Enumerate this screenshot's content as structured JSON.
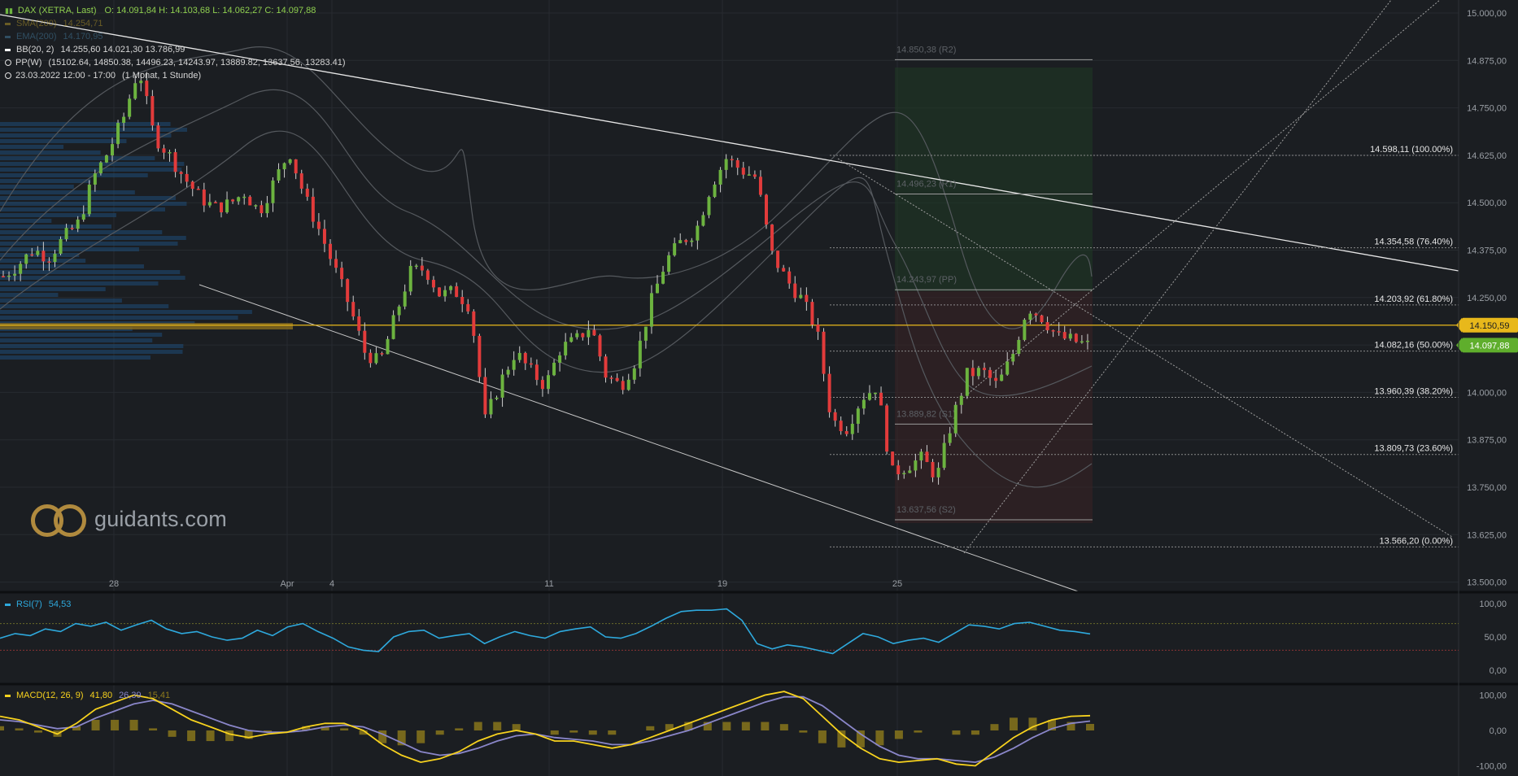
{
  "header": {
    "symbol": "DAX (XETRA, Last)",
    "ohlc": "O: 14.091,84  H: 14.103,68  L: 14.062,27  C: 14.097,88",
    "sma_label": "SMA(200)",
    "sma_value": "14.254,71",
    "ema_label": "EMA(200)",
    "ema_value": "14.170,95",
    "bb_label": "BB(20, 2)",
    "bb_values": "14.255,60  14.021,30  13.786,99",
    "pp_label": "PP(W)",
    "pp_values": "(15102.64, 14850.38, 14496.23, 14243.97, 13889.82, 13637.56, 13283.41)",
    "range": "23.03.2022 12:00 - 17:00",
    "period": "(1 Monat, 1 Stunde)"
  },
  "logo": {
    "text": "guidants.com"
  },
  "rsi": {
    "label": "RSI(7)",
    "value": "54,53"
  },
  "macd": {
    "label": "MACD(12, 26, 9)",
    "v1": "41,80",
    "v2": "26,39",
    "v3": "15,41"
  },
  "colors": {
    "bg": "#1b1e22",
    "up": "#6cb33f",
    "down": "#e23b3b",
    "rsi": "#2ea9dd",
    "macd": "#f7d21e",
    "signal": "#8a86c9",
    "hist": "#8e7a1c",
    "price_tag": "#e8b81b",
    "close_tag": "#5fae2c"
  },
  "chart_data": {
    "type": "candlestick",
    "timeframe": "1 hour",
    "price_axis": {
      "range": [
        13500,
        15000
      ],
      "ticks": [
        "15.000,00",
        "14.875,00",
        "14.750,00",
        "14.625,00",
        "14.500,00",
        "14.375,00",
        "14.250,00",
        "14.125,00",
        "14.000,00",
        "13.875,00",
        "13.750,00",
        "13.625,00",
        "13.500,00"
      ]
    },
    "x_labels": [
      "28",
      "Apr",
      "4",
      "11",
      "19",
      "25"
    ],
    "close_path": [
      14280,
      14310,
      14350,
      14330,
      14380,
      14420,
      14540,
      14610,
      14700,
      14830,
      14650,
      14600,
      14540,
      14490,
      14460,
      14470,
      14500,
      14450,
      14530,
      14610,
      14490,
      14400,
      14300,
      14200,
      14080,
      14050,
      14170,
      14290,
      14300,
      14230,
      14240,
      14200,
      13900,
      14000,
      14080,
      14030,
      13990,
      14090,
      14110,
      14150,
      14020,
      13990,
      14060,
      14210,
      14320,
      14370,
      14400,
      14520,
      14590,
      14560,
      14540,
      14340,
      14270,
      14220,
      14140,
      13900,
      13880,
      13960,
      13990,
      13760,
      13780,
      13800,
      13750,
      13900,
      14020,
      14030,
      13990,
      14070,
      14200,
      14170,
      14120,
      14110,
      14098
    ],
    "last_close": "14.097,88",
    "horizontal_line": "14.150,59",
    "fibonacci": [
      {
        "label": "14.598,11 (100.00%)",
        "value": 14598.11
      },
      {
        "label": "14.354,58 (76.40%)",
        "value": 14354.58
      },
      {
        "label": "14.203,92 (61.80%)",
        "value": 14203.92
      },
      {
        "label": "14.082,16 (50.00%)",
        "value": 14082.16
      },
      {
        "label": "13.960,39 (38.20%)",
        "value": 13960.39
      },
      {
        "label": "13.809,73 (23.60%)",
        "value": 13809.73
      },
      {
        "label": "13.566,20 (0.00%)",
        "value": 13566.2
      }
    ],
    "pivots": [
      {
        "label": "14.850,38 (R2)",
        "value": 14850.38
      },
      {
        "label": "14.496,23 (R1)",
        "value": 14496.23
      },
      {
        "label": "14.243,97 (PP)",
        "value": 14243.97
      },
      {
        "label": "13.889,82 (S1)",
        "value": 13889.82
      },
      {
        "label": "13.637,56 (S2)",
        "value": 13637.56
      }
    ],
    "rsi_axis": {
      "range": [
        0,
        100
      ],
      "ticks": [
        "100,00",
        "50,00",
        "0,00"
      ],
      "levels": [
        70,
        30
      ]
    },
    "rsi_path": [
      48,
      55,
      52,
      62,
      58,
      70,
      66,
      72,
      60,
      68,
      75,
      62,
      55,
      58,
      50,
      45,
      48,
      60,
      52,
      65,
      70,
      58,
      48,
      35,
      30,
      28,
      50,
      58,
      60,
      48,
      52,
      55,
      40,
      50,
      58,
      52,
      48,
      58,
      62,
      65,
      50,
      48,
      55,
      66,
      78,
      88,
      90,
      90,
      92,
      75,
      40,
      32,
      38,
      35,
      30,
      25,
      40,
      55,
      50,
      40,
      45,
      48,
      42,
      55,
      68,
      66,
      62,
      70,
      72,
      66,
      60,
      58,
      54.53
    ],
    "macd_axis": {
      "range": [
        -100,
        100
      ],
      "ticks": [
        "100,00",
        "0,00",
        "-100,00"
      ]
    },
    "macd_path": [
      40,
      30,
      10,
      -10,
      20,
      60,
      80,
      100,
      90,
      60,
      30,
      10,
      -10,
      -20,
      -10,
      -5,
      10,
      20,
      20,
      0,
      -40,
      -70,
      -90,
      -80,
      -60,
      -30,
      -10,
      0,
      -10,
      -30,
      -30,
      -40,
      -50,
      -40,
      -20,
      0,
      20,
      40,
      60,
      80,
      100,
      110,
      90,
      40,
      -10,
      -50,
      -80,
      -90,
      -85,
      -80,
      -95,
      -100,
      -60,
      -20,
      10,
      30,
      40,
      41.8
    ],
    "signal_path": [
      30,
      25,
      15,
      5,
      10,
      35,
      55,
      75,
      85,
      75,
      55,
      35,
      15,
      0,
      -5,
      -5,
      0,
      10,
      15,
      10,
      -10,
      -35,
      -60,
      -70,
      -65,
      -50,
      -30,
      -15,
      -10,
      -20,
      -25,
      -30,
      -40,
      -40,
      -30,
      -15,
      0,
      20,
      40,
      60,
      80,
      95,
      95,
      70,
      30,
      -10,
      -45,
      -70,
      -80,
      -80,
      -85,
      -90,
      -75,
      -50,
      -20,
      5,
      20,
      26.39
    ],
    "macd_hist": [
      15.41
    ]
  }
}
